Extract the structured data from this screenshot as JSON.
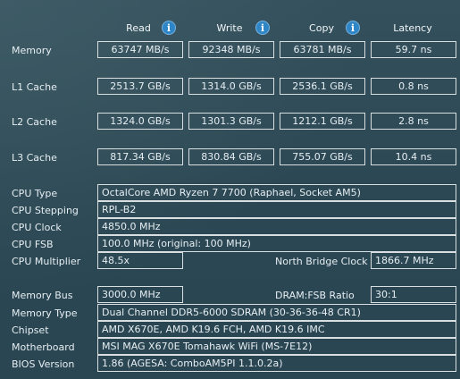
{
  "headers": {
    "read": "Read",
    "write": "Write",
    "copy": "Copy",
    "latency": "Latency"
  },
  "icons": {
    "info": "info-icon"
  },
  "rows": {
    "memory": {
      "label": "Memory",
      "read": "63747 MB/s",
      "write": "92348 MB/s",
      "copy": "63781 MB/s",
      "latency": "59.7 ns"
    },
    "l1": {
      "label": "L1 Cache",
      "read": "2513.7 GB/s",
      "write": "1314.0 GB/s",
      "copy": "2536.1 GB/s",
      "latency": "0.8 ns"
    },
    "l2": {
      "label": "L2 Cache",
      "read": "1324.0 GB/s",
      "write": "1301.3 GB/s",
      "copy": "1212.1 GB/s",
      "latency": "2.8 ns"
    },
    "l3": {
      "label": "L3 Cache",
      "read": "817.34 GB/s",
      "write": "830.84 GB/s",
      "copy": "755.07 GB/s",
      "latency": "10.4 ns"
    }
  },
  "cpu": {
    "type_label": "CPU Type",
    "type_value": "OctalCore AMD Ryzen 7 7700  (Raphael, Socket AM5)",
    "stepping_label": "CPU Stepping",
    "stepping_value": "RPL-B2",
    "clock_label": "CPU Clock",
    "clock_value": "4850.0 MHz",
    "fsb_label": "CPU FSB",
    "fsb_value": "100.0 MHz  (original: 100 MHz)",
    "multiplier_label": "CPU Multiplier",
    "multiplier_value": "48.5x",
    "nb_clock_label": "North Bridge Clock",
    "nb_clock_value": "1866.7 MHz"
  },
  "system": {
    "membus_label": "Memory Bus",
    "membus_value": "3000.0 MHz",
    "dram_ratio_label": "DRAM:FSB Ratio",
    "dram_ratio_value": "30:1",
    "memtype_label": "Memory Type",
    "memtype_value": "Dual Channel DDR5-6000 SDRAM  (30-36-36-48 CR1)",
    "chipset_label": "Chipset",
    "chipset_value": "AMD X670E, AMD K19.6 FCH, AMD K19.6 IMC",
    "motherboard_label": "Motherboard",
    "motherboard_value": "MSI MAG X670E Tomahawk WiFi (MS-7E12)",
    "bios_label": "BIOS Version",
    "bios_value": "1.86  (AGESA: ComboAM5PI 1.1.0.2a)"
  }
}
